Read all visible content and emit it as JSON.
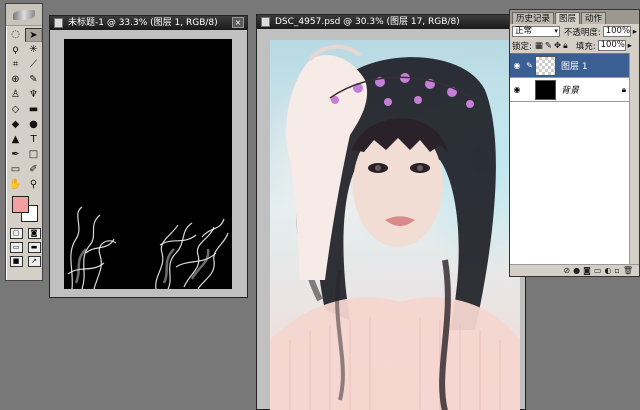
{
  "toolbox": {
    "tools": [
      {
        "name": "marquee-tool-icon",
        "glyph": "◌"
      },
      {
        "name": "move-tool-icon",
        "glyph": "➤"
      },
      {
        "name": "lasso-tool-icon",
        "glyph": "ϙ"
      },
      {
        "name": "magic-wand-tool-icon",
        "glyph": "✳"
      },
      {
        "name": "crop-tool-icon",
        "glyph": "⌗"
      },
      {
        "name": "slice-tool-icon",
        "glyph": "⟋"
      },
      {
        "name": "healing-brush-tool-icon",
        "glyph": "⊕"
      },
      {
        "name": "brush-tool-icon",
        "glyph": "✎"
      },
      {
        "name": "clone-stamp-tool-icon",
        "glyph": "♙"
      },
      {
        "name": "history-brush-tool-icon",
        "glyph": "♆"
      },
      {
        "name": "eraser-tool-icon",
        "glyph": "◇"
      },
      {
        "name": "gradient-tool-icon",
        "glyph": "▬"
      },
      {
        "name": "blur-tool-icon",
        "glyph": "◆"
      },
      {
        "name": "dodge-tool-icon",
        "glyph": "●"
      },
      {
        "name": "path-selection-tool-icon",
        "glyph": "▲"
      },
      {
        "name": "type-tool-icon",
        "glyph": "T"
      },
      {
        "name": "pen-tool-icon",
        "glyph": "✒"
      },
      {
        "name": "shape-tool-icon",
        "glyph": "□"
      },
      {
        "name": "notes-tool-icon",
        "glyph": "▭"
      },
      {
        "name": "eyedropper-tool-icon",
        "glyph": "✐"
      },
      {
        "name": "hand-tool-icon",
        "glyph": "✋"
      },
      {
        "name": "zoom-tool-icon",
        "glyph": "⚲"
      }
    ],
    "foreground_color": "#f4a0a0",
    "background_color": "#ffffff"
  },
  "doc1": {
    "title": "未标题-1 @ 33.3% (图层 1, RGB/8)"
  },
  "doc2": {
    "title": "DSC_4957.psd @ 30.3% (图层 17, RGB/8)"
  },
  "layers_panel": {
    "tabs": [
      "历史记录",
      "图层",
      "动作"
    ],
    "active_tab": 1,
    "blend_mode_value": "正常",
    "opacity_label": "不透明度:",
    "opacity_value": "100%",
    "lock_label": "锁定:",
    "fill_label": "填充:",
    "fill_value": "100%",
    "layers": [
      {
        "name": "图层 1",
        "selected": true
      },
      {
        "name": "背景",
        "selected": false
      }
    ],
    "close_glyph": "×"
  }
}
